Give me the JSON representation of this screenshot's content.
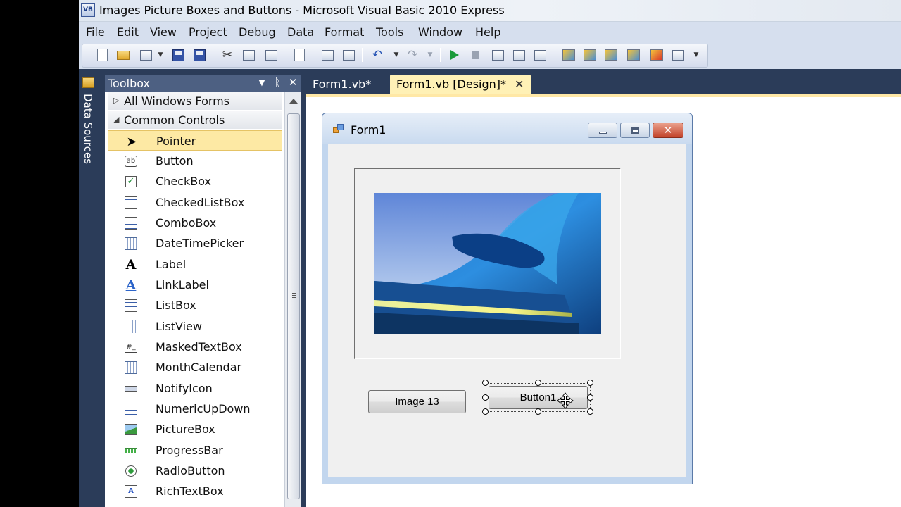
{
  "window": {
    "icon_text": "VB",
    "title": "Images Picture Boxes and Buttons - Microsoft Visual Basic 2010 Express"
  },
  "menu": [
    "File",
    "Edit",
    "View",
    "Project",
    "Debug",
    "Data",
    "Format",
    "Tools",
    "Window",
    "Help"
  ],
  "side_tab": {
    "label": "Data Sources"
  },
  "toolbox": {
    "title": "Toolbox",
    "pin_glyph": "▼",
    "autohide_glyph": "ᚱ",
    "close_glyph": "✕",
    "groups": {
      "all": {
        "arrow": "▷",
        "label": "All Windows Forms"
      },
      "common": {
        "arrow": "◢",
        "label": "Common Controls"
      }
    },
    "items": [
      {
        "label": "Pointer",
        "icon": "pointer-icon"
      },
      {
        "label": "Button",
        "icon": "button-icon",
        "icon_text": "ab"
      },
      {
        "label": "CheckBox",
        "icon": "checkbox-icon",
        "icon_text": "✓"
      },
      {
        "label": "CheckedListBox",
        "icon": "checkedlistbox-icon"
      },
      {
        "label": "ComboBox",
        "icon": "combobox-icon"
      },
      {
        "label": "DateTimePicker",
        "icon": "datetimepicker-icon"
      },
      {
        "label": "Label",
        "icon": "label-icon",
        "icon_text": "A"
      },
      {
        "label": "LinkLabel",
        "icon": "linklabel-icon",
        "icon_text": "A"
      },
      {
        "label": "ListBox",
        "icon": "listbox-icon"
      },
      {
        "label": "ListView",
        "icon": "listview-icon"
      },
      {
        "label": "MaskedTextBox",
        "icon": "maskedtextbox-icon",
        "icon_text": "#_"
      },
      {
        "label": "MonthCalendar",
        "icon": "monthcalendar-icon"
      },
      {
        "label": "NotifyIcon",
        "icon": "notifyicon-icon"
      },
      {
        "label": "NumericUpDown",
        "icon": "numericupdown-icon"
      },
      {
        "label": "PictureBox",
        "icon": "picturebox-icon"
      },
      {
        "label": "ProgressBar",
        "icon": "progressbar-icon"
      },
      {
        "label": "RadioButton",
        "icon": "radiobutton-icon"
      },
      {
        "label": "RichTextBox",
        "icon": "richtextbox-icon",
        "icon_text": "A"
      }
    ]
  },
  "tabs": [
    {
      "label": "Form1.vb*",
      "active": false
    },
    {
      "label": "Form1.vb [Design]*",
      "active": true,
      "close": "✕"
    }
  ],
  "form": {
    "title": "Form1",
    "close_glyph": "✕",
    "buttons": {
      "image": "Image 13",
      "button1": "Button1"
    }
  },
  "colors": {
    "ide_background": "#2b3c59",
    "active_tab": "#fff1b6",
    "selected_toolbox_item": "#fde9a4"
  }
}
